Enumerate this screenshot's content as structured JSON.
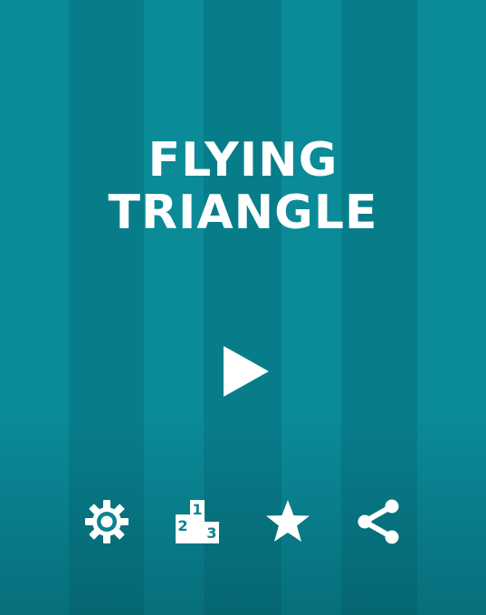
{
  "game": {
    "title_line1": "FLYING",
    "title_line2": "TRIANGLE"
  },
  "colors": {
    "background": "#0a8390",
    "stripe_light": "#0b8a98",
    "stripe_dark": "#087d8a",
    "foreground": "#ffffff"
  },
  "menu": {
    "play_icon": "play-icon",
    "buttons": [
      {
        "icon": "gear-icon"
      },
      {
        "icon": "leaderboard-icon",
        "podium_labels": [
          "1",
          "2",
          "3"
        ]
      },
      {
        "icon": "star-icon"
      },
      {
        "icon": "share-icon"
      }
    ]
  }
}
